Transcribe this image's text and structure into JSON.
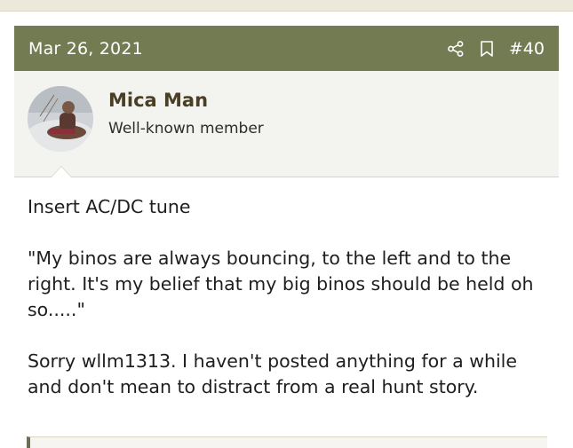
{
  "post": {
    "date": "Mar 26, 2021",
    "number": "#40",
    "icons": {
      "share": "share-icon",
      "bookmark": "bookmark-icon"
    },
    "author": {
      "name": "Mica Man",
      "title": "Well-known member"
    },
    "body": {
      "p1": "Insert AC/DC tune",
      "p2": "\"My binos are always bouncing, to the left and to the right. It's my belief that my big binos should be held oh so.....\"",
      "p3": "Sorry wllm1313. I haven't posted anything for a while and don't mean to distract from a real hunt story."
    }
  },
  "colors": {
    "header_bg": "#737b53",
    "username": "#4a3f25",
    "user_block_bg": "#f3f3f0"
  }
}
